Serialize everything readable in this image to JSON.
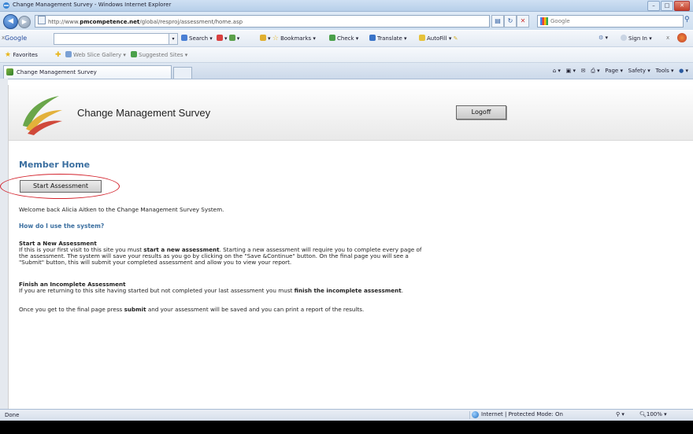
{
  "window": {
    "title": "Change Management Survey - Windows Internet Explorer"
  },
  "address_bar": {
    "url_prefix": "http://www.",
    "url_domain": "pmcompetence.net",
    "url_path": "/global/resproj/assessment/home.asp",
    "search_placeholder": "Google"
  },
  "google_toolbar": {
    "label": "Google",
    "items": [
      "Search",
      "Bookmarks",
      "Check",
      "Translate",
      "AutoFill"
    ],
    "right": [
      "Sign In"
    ]
  },
  "favorites_bar": {
    "favorites_label": "Favorites",
    "items": [
      "Web Slice Gallery",
      "Suggested Sites"
    ]
  },
  "tab": {
    "label": "Change Management Survey"
  },
  "command_bar": {
    "items": [
      "Page",
      "Safety",
      "Tools"
    ]
  },
  "page": {
    "app_title": "Change Management Survey",
    "logoff_label": "Logoff",
    "heading": "Member Home",
    "start_button": "Start Assessment",
    "welcome": "Welcome back Alicia Aitken to the Change Management Survey System.",
    "how_heading": "How do I use the system?",
    "start_new_heading": "Start a New Assessment",
    "start_new_line1_a": "If this is your first visit to this site you must ",
    "start_new_line1_b": "start a new assessment",
    "start_new_line1_c": ". Starting a new assessment will require you to complete every page of",
    "start_new_line2": "the assessment. The system will save your results as you go by clicking on the \"Save &Continue\" button. On the final page you will see a",
    "start_new_line3": "\"Submit\" button, this will submit your completed assessment and allow you to view your report.",
    "finish_heading": "Finish an Incomplete Assessment",
    "finish_line_a": "If you are returning to this site having started but not completed your last assessment you must ",
    "finish_line_b": "finish the incomplete assessment",
    "finish_line_c": ".",
    "final_a": "Once you get to the final page press ",
    "final_b": "submit",
    "final_c": " and your assessment will be saved and you can print a report of the results."
  },
  "status_bar": {
    "status": "Done",
    "zone": "Internet | Protected Mode: On",
    "zoom": "100%"
  },
  "colors": {
    "heading_blue": "#3b6fa0",
    "annotation_red": "#d3212b"
  }
}
